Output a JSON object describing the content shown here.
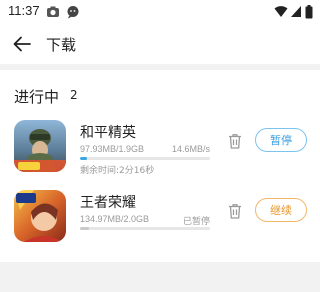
{
  "status_bar": {
    "time": "11:37",
    "icons": [
      "camera-icon",
      "chat-icon",
      "wifi-icon",
      "signal-icon",
      "battery-icon"
    ]
  },
  "app_bar": {
    "back_icon": "arrow-left-icon",
    "title": "下载"
  },
  "section": {
    "title": "进行中",
    "count": "2"
  },
  "downloads": [
    {
      "name": "和平精英",
      "icon": "peace-elite-app-icon",
      "size": "97.93MB/1.9GB",
      "status": "14.6MB/s",
      "remaining": "剩余时间:2分16秒",
      "progress": 0.05,
      "action": "暂停",
      "state": "downloading"
    },
    {
      "name": "王者荣耀",
      "icon": "honor-of-kings-app-icon",
      "size": "134.97MB/2.0GB",
      "status": "已暂停",
      "remaining": "",
      "progress": 0.066,
      "action": "继续",
      "state": "paused"
    }
  ],
  "colors": {
    "accent_blue": "#39a7e6",
    "resume_orange": "#e8962a",
    "background": "#f2f2f2"
  }
}
